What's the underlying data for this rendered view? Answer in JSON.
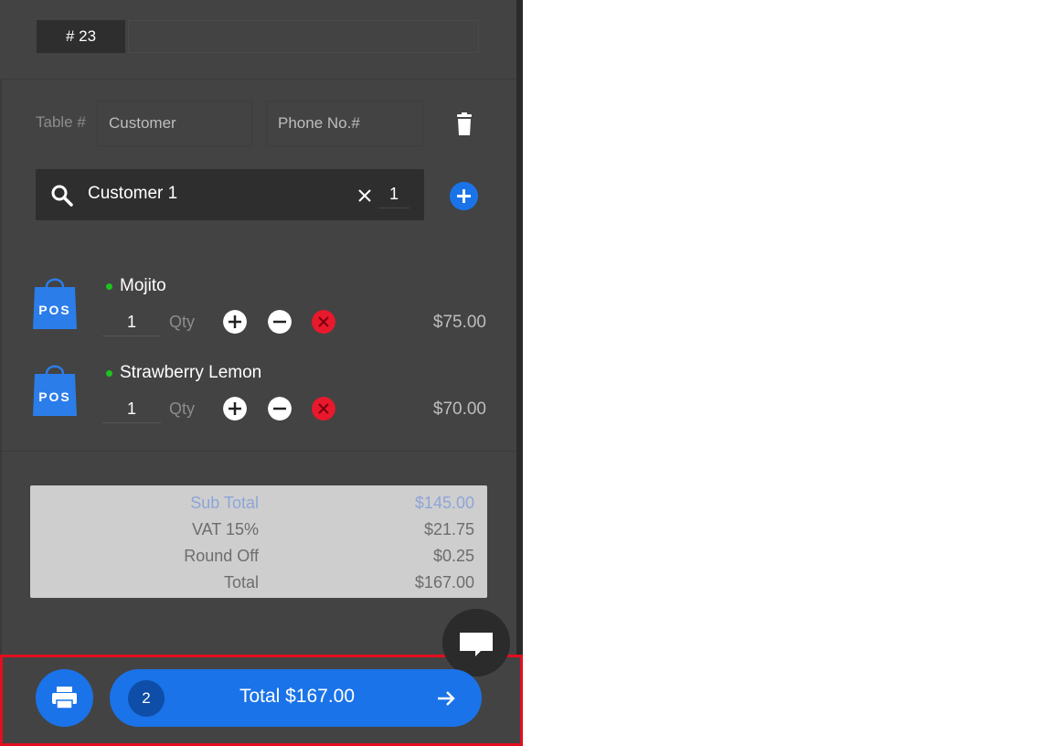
{
  "order": {
    "number": "# 23"
  },
  "fields": {
    "table_label": "Table #",
    "customer_placeholder": "Customer",
    "phone_placeholder": "Phone No.#"
  },
  "search": {
    "customer": "Customer 1",
    "count": "1"
  },
  "items": [
    {
      "name": "Mojito",
      "qty": "1",
      "qty_label": "Qty",
      "price": "$75.00",
      "icon_text": "POS"
    },
    {
      "name": "Strawberry Lemon",
      "qty": "1",
      "qty_label": "Qty",
      "price": "$70.00",
      "icon_text": "POS"
    }
  ],
  "totals": [
    {
      "label": "Sub Total",
      "value": "$145.00"
    },
    {
      "label": "VAT 15%",
      "value": "$21.75"
    },
    {
      "label": "Round Off",
      "value": "$0.25"
    },
    {
      "label": "Total",
      "value": "$167.00"
    }
  ],
  "footer": {
    "item_count": "2",
    "total_label": "Total $167.00"
  },
  "colors": {
    "accent": "#1a73e8",
    "danger": "#e8192c",
    "status_dot": "#1ec31e",
    "highlight_border": "#e30e1f"
  },
  "icons": [
    "search-icon",
    "close-icon",
    "plus-icon",
    "trash-icon",
    "minus-icon",
    "remove-icon",
    "print-icon",
    "arrow-right-icon",
    "chat-icon",
    "pos-bag-icon"
  ]
}
